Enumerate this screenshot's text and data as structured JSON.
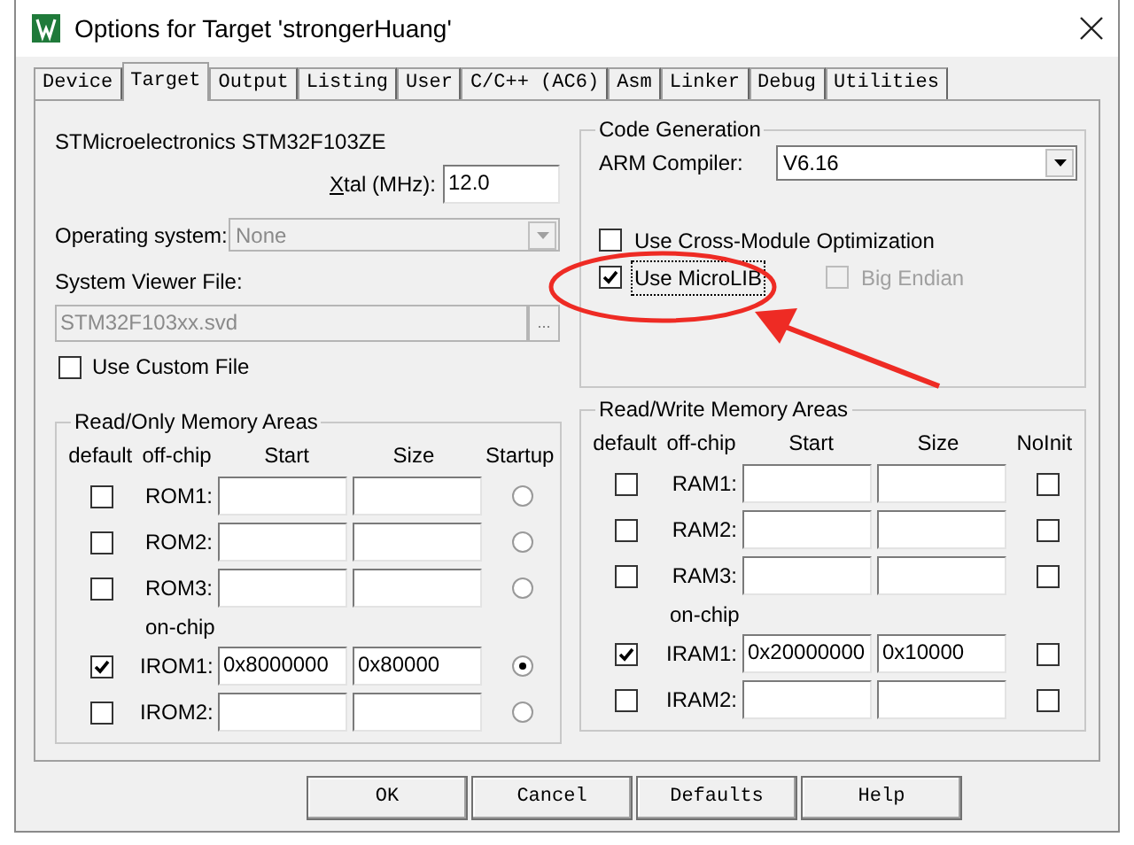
{
  "window": {
    "title": "Options for Target 'strongerHuang'"
  },
  "tabs": [
    {
      "label": "Device",
      "selected": false
    },
    {
      "label": "Target",
      "selected": true
    },
    {
      "label": "Output",
      "selected": false
    },
    {
      "label": "Listing",
      "selected": false
    },
    {
      "label": "User",
      "selected": false
    },
    {
      "label": "C/C++ (AC6)",
      "selected": false
    },
    {
      "label": "Asm",
      "selected": false
    },
    {
      "label": "Linker",
      "selected": false
    },
    {
      "label": "Debug",
      "selected": false
    },
    {
      "label": "Utilities",
      "selected": false
    }
  ],
  "device": "STMicroelectronics STM32F103ZE",
  "xtal": {
    "label": "Xtal (MHz):",
    "value": "12.0"
  },
  "operating_system": {
    "label": "Operating system:",
    "value": "None",
    "disabled": true
  },
  "system_viewer_file": {
    "label": "System Viewer File:",
    "value": "STM32F103xx.svd",
    "disabled": true,
    "browse": "..."
  },
  "use_custom_file": {
    "label": "Use Custom File",
    "checked": false
  },
  "code_generation": {
    "title": "Code Generation",
    "compiler_label": "ARM Compiler:",
    "compiler": "V6.16",
    "options": [
      {
        "label": "Use Cross-Module Optimization",
        "checked": false,
        "disabled": false,
        "focused": false
      },
      {
        "label": "Use MicroLIB",
        "checked": true,
        "disabled": false,
        "focused": true
      },
      {
        "label": "Big Endian",
        "checked": false,
        "disabled": true,
        "focused": false
      }
    ]
  },
  "memory_areas": [
    {
      "title": "Read/Only Memory Areas",
      "kind": "radio",
      "columns": [
        "default",
        "off-chip",
        "Start",
        "Size",
        "Startup"
      ],
      "off_chip_rows": [
        {
          "default": false,
          "name": "ROM1:",
          "selected": false
        },
        {
          "default": false,
          "name": "ROM2:",
          "selected": false
        },
        {
          "default": false,
          "name": "ROM3:",
          "selected": false
        }
      ],
      "on_chip": {
        "label": "on-chip",
        "rows": [
          {
            "default": true,
            "name": "IROM1:",
            "start": "0x8000000",
            "size": "0x80000",
            "selected": true
          },
          {
            "default": false,
            "name": "IROM2:",
            "selected": false
          }
        ]
      }
    },
    {
      "title": "Read/Write Memory Areas",
      "kind": "checkbox",
      "columns": [
        "default",
        "off-chip",
        "Start",
        "Size",
        "NoInit"
      ],
      "off_chip_rows": [
        {
          "default": false,
          "name": "RAM1:",
          "checked": false
        },
        {
          "default": false,
          "name": "RAM2:",
          "checked": false
        },
        {
          "default": false,
          "name": "RAM3:",
          "checked": false
        }
      ],
      "on_chip": {
        "label": "on-chip",
        "rows": [
          {
            "default": true,
            "name": "IRAM1:",
            "start": "0x20000000",
            "size": "0x10000",
            "checked": false
          },
          {
            "default": false,
            "name": "IRAM2:",
            "checked": false
          }
        ]
      }
    }
  ],
  "buttons": [
    "OK",
    "Cancel",
    "Defaults",
    "Help"
  ]
}
